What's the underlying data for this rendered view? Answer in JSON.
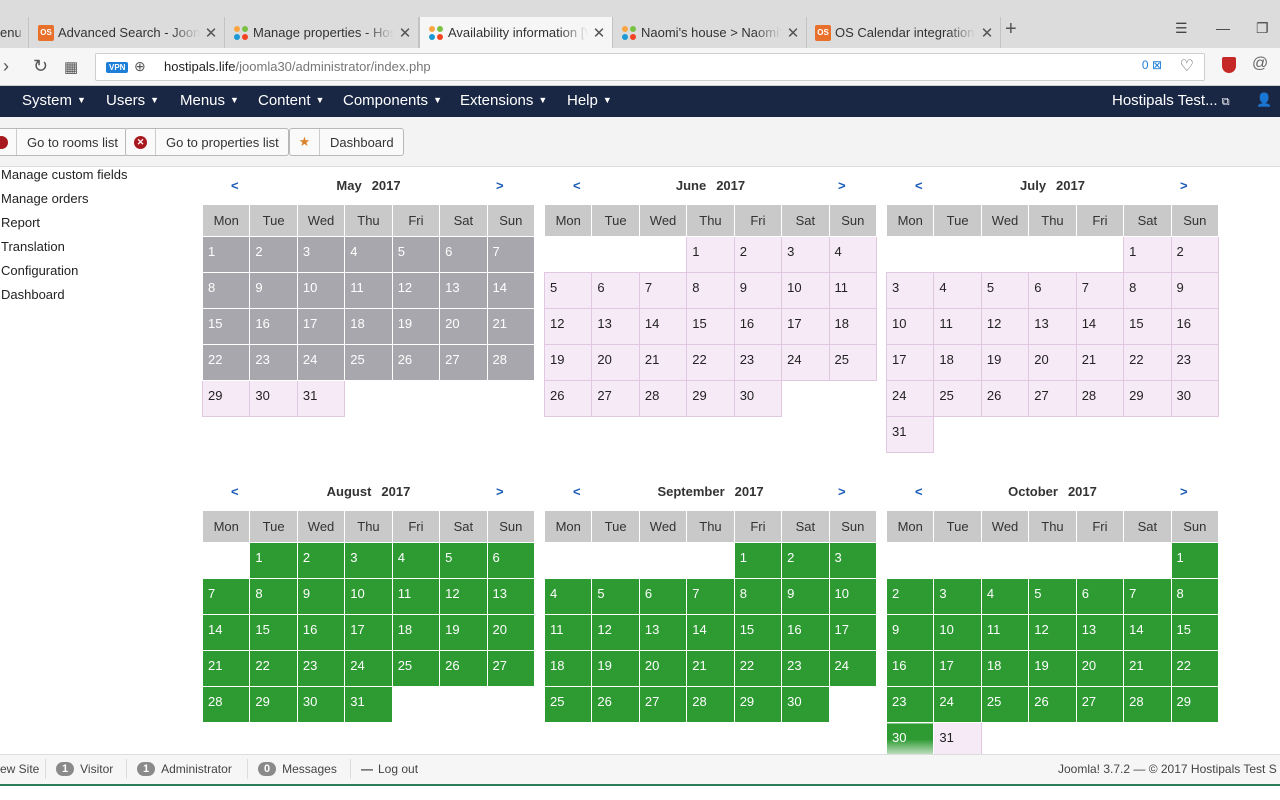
{
  "browser": {
    "tabs": [
      {
        "label": "enu",
        "icon": "none"
      },
      {
        "label": "Advanced Search - Joom D",
        "icon": "os-icon"
      },
      {
        "label": "Manage properties - Hosti",
        "icon": "joomla-icon"
      },
      {
        "label": "Availability information [W",
        "icon": "joomla-icon"
      },
      {
        "label": "Naomi's house > Naomi's",
        "icon": "joomla-icon"
      },
      {
        "label": "OS Calendar integration (1",
        "icon": "os-icon"
      }
    ],
    "url_host": "hostipals.life",
    "url_path": "/joomla30/administrator/index.php",
    "vpn_label": "VPN",
    "adblock_count": "0"
  },
  "navbar": {
    "menus": [
      "System",
      "Users",
      "Menus",
      "Content",
      "Components",
      "Extensions",
      "Help"
    ],
    "site_name": "Hostipals Test..."
  },
  "toolbar": {
    "rooms": "Go to rooms list",
    "properties": "Go to properties list",
    "dashboard": "Dashboard"
  },
  "sidebar": [
    "Manage custom fields",
    "Manage orders",
    "Report",
    "Translation",
    "Configuration",
    "Dashboard"
  ],
  "weekdays": [
    "Mon",
    "Tue",
    "Wed",
    "Thu",
    "Fri",
    "Sat",
    "Sun"
  ],
  "calendar_nav": {
    "prev": "<",
    "next": ">"
  },
  "legend_colors": {
    "past": "#a8a7ad",
    "available": "#f7eaf7",
    "booked": "#2d9a32"
  },
  "calendars": [
    {
      "month": "May",
      "year": "2017",
      "offset": 0,
      "days": 31,
      "past_until": 28,
      "booked": []
    },
    {
      "month": "June",
      "year": "2017",
      "offset": 3,
      "days": 30,
      "past_until": 0,
      "booked": []
    },
    {
      "month": "July",
      "year": "2017",
      "offset": 5,
      "days": 31,
      "past_until": 0,
      "booked": []
    },
    {
      "month": "August",
      "year": "2017",
      "offset": 1,
      "days": 31,
      "past_until": 0,
      "booked_from": 1,
      "booked_to": 31
    },
    {
      "month": "September",
      "year": "2017",
      "offset": 4,
      "days": 30,
      "past_until": 0,
      "booked_from": 1,
      "booked_to": 30
    },
    {
      "month": "October",
      "year": "2017",
      "offset": 6,
      "days": 31,
      "past_until": 0,
      "booked_from": 1,
      "booked_to": 29,
      "half_day": 30
    }
  ],
  "statusbar": {
    "view_site": "ew Site",
    "visitors_count": "1",
    "visitors_label": "Visitor",
    "admins_count": "1",
    "admins_label": "Administrator",
    "messages_count": "0",
    "messages_label": "Messages",
    "logout": "Log out",
    "version": "Joomla! 3.7.2  —  © 2017 Hostipals Test S"
  }
}
